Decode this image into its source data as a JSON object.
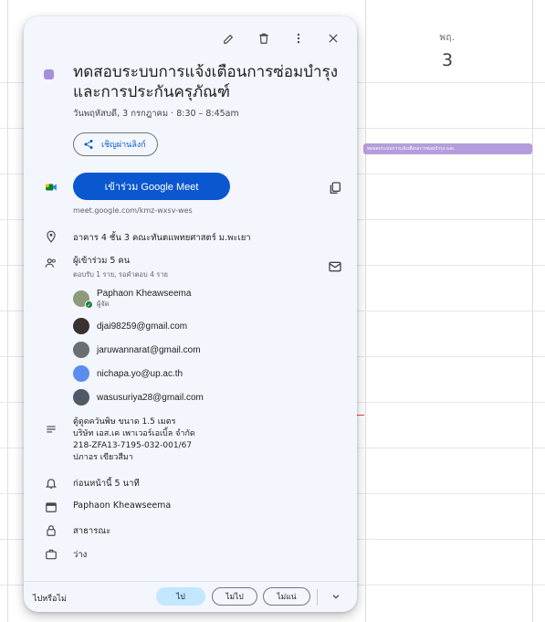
{
  "calendar": {
    "day_abbr": "พฤ.",
    "day_number": "3",
    "event_chip": "ทดสอบระบบการแจ้งเตือนการซ่อมบำรุง และ"
  },
  "toolbar": {
    "edit_icon": "pencil-icon",
    "delete_icon": "trash-icon",
    "more_icon": "more-vert-icon",
    "close_icon": "close-icon"
  },
  "event": {
    "color": "#a58fd8",
    "title": "ทดสอบระบบการแจ้งเตือนการซ่อมบำรุงและการประกันครุภัณฑ์",
    "date_line": "วันพฤหัสบดี, 3 กรกฎาคม  ·  8:30 – 8:45am",
    "share_label": "เชิญผ่านลิงก์"
  },
  "meet": {
    "button_label": "เข้าร่วม Google Meet",
    "url": "meet.google.com/kmz-wxsv-wes"
  },
  "location": "อาคาร 4 ชั้น 3 คณะทันตแพทยศาสตร์ ม.พะเยา",
  "guests": {
    "summary": "ผู้เข้าร่วม 5 คน",
    "status": "ตอบรับ 1 ราย, รอคำตอบ 4 ราย",
    "list": [
      {
        "name": "Paphaon Kheawseema",
        "role": "ผู้จัด"
      },
      {
        "name": "djai98259@gmail.com",
        "role": ""
      },
      {
        "name": "jaruwannarat@gmail.com",
        "role": ""
      },
      {
        "name": "nichapa.yo@up.ac.th",
        "role": ""
      },
      {
        "name": "wasusuriya28@gmail.com",
        "role": ""
      }
    ]
  },
  "description": "ตู้ดูดควันพิษ ขนาด 1.5 เมตร\nบริษัท เอส.เค เพาเวอร์เอเบิ้ล จำกัด\n218-ZFA13-7195-032-001/67\nปภาอร เขียวสีมา",
  "notification": "ก่อนหน้านี้ 5 นาที",
  "organizer_calendar": "Paphaon Kheawseema",
  "visibility": "สาธารณะ",
  "availability": "ว่าง",
  "footer": {
    "label": "ไปหรือไม่",
    "yes": "ไป",
    "no": "ไม่ไป",
    "maybe": "ไม่แน่"
  }
}
